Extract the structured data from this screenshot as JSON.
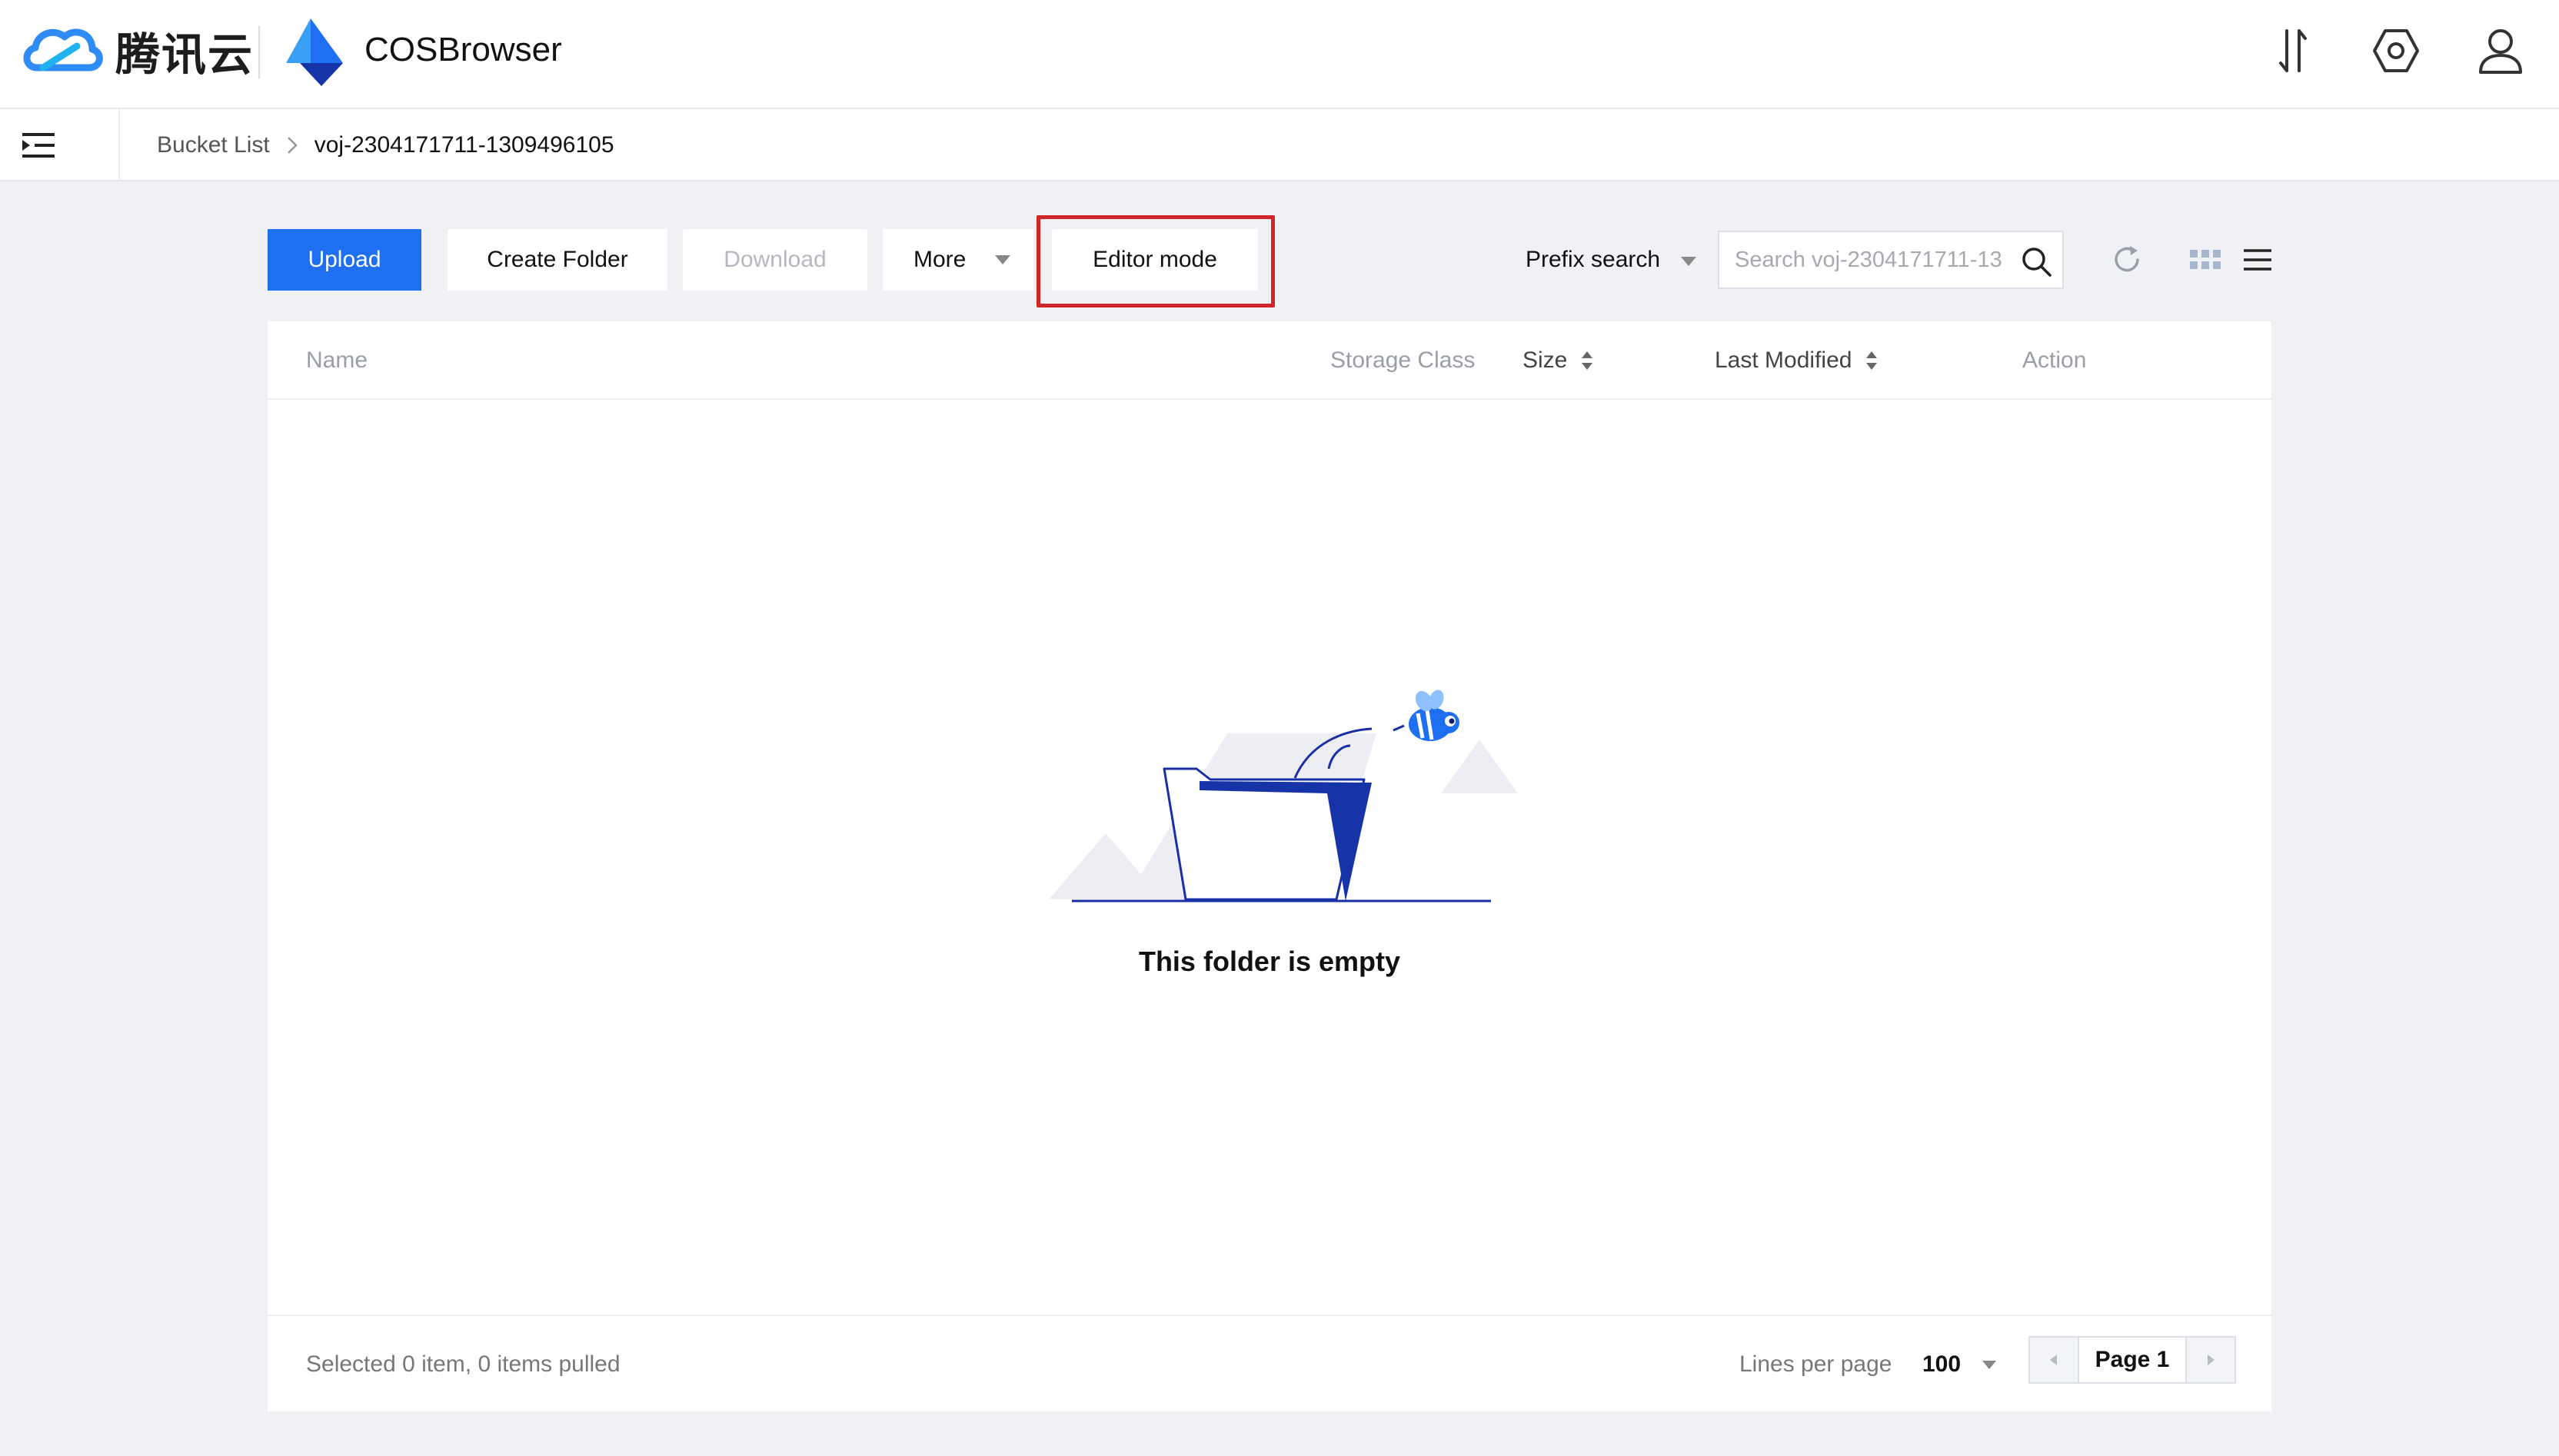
{
  "header": {
    "brand_name": "腾讯云",
    "app_name": "COSBrowser",
    "icons": [
      "transfer-icon",
      "settings-icon",
      "user-icon"
    ]
  },
  "breadcrumb": {
    "root": "Bucket List",
    "current": "voj-2304171711-1309496105"
  },
  "toolbar": {
    "upload": "Upload",
    "create_folder": "Create Folder",
    "download": "Download",
    "more": "More",
    "editor_mode": "Editor mode",
    "search_mode": "Prefix search",
    "search_placeholder": "Search voj-2304171711-13",
    "icons": [
      "refresh-icon",
      "grid-view-icon",
      "list-view-icon"
    ]
  },
  "table": {
    "columns": {
      "name": "Name",
      "storage_class": "Storage Class",
      "size": "Size",
      "last_modified": "Last Modified",
      "action": "Action"
    },
    "rows": [],
    "empty_text": "This folder is empty"
  },
  "footer": {
    "status": "Selected 0 item, 0 items pulled",
    "lines_label": "Lines per page",
    "lines_value": "100",
    "page_label": "Page 1"
  },
  "colors": {
    "accent": "#1f6ff2",
    "highlight_border": "#d0262a",
    "background": "#f0f1f5"
  }
}
